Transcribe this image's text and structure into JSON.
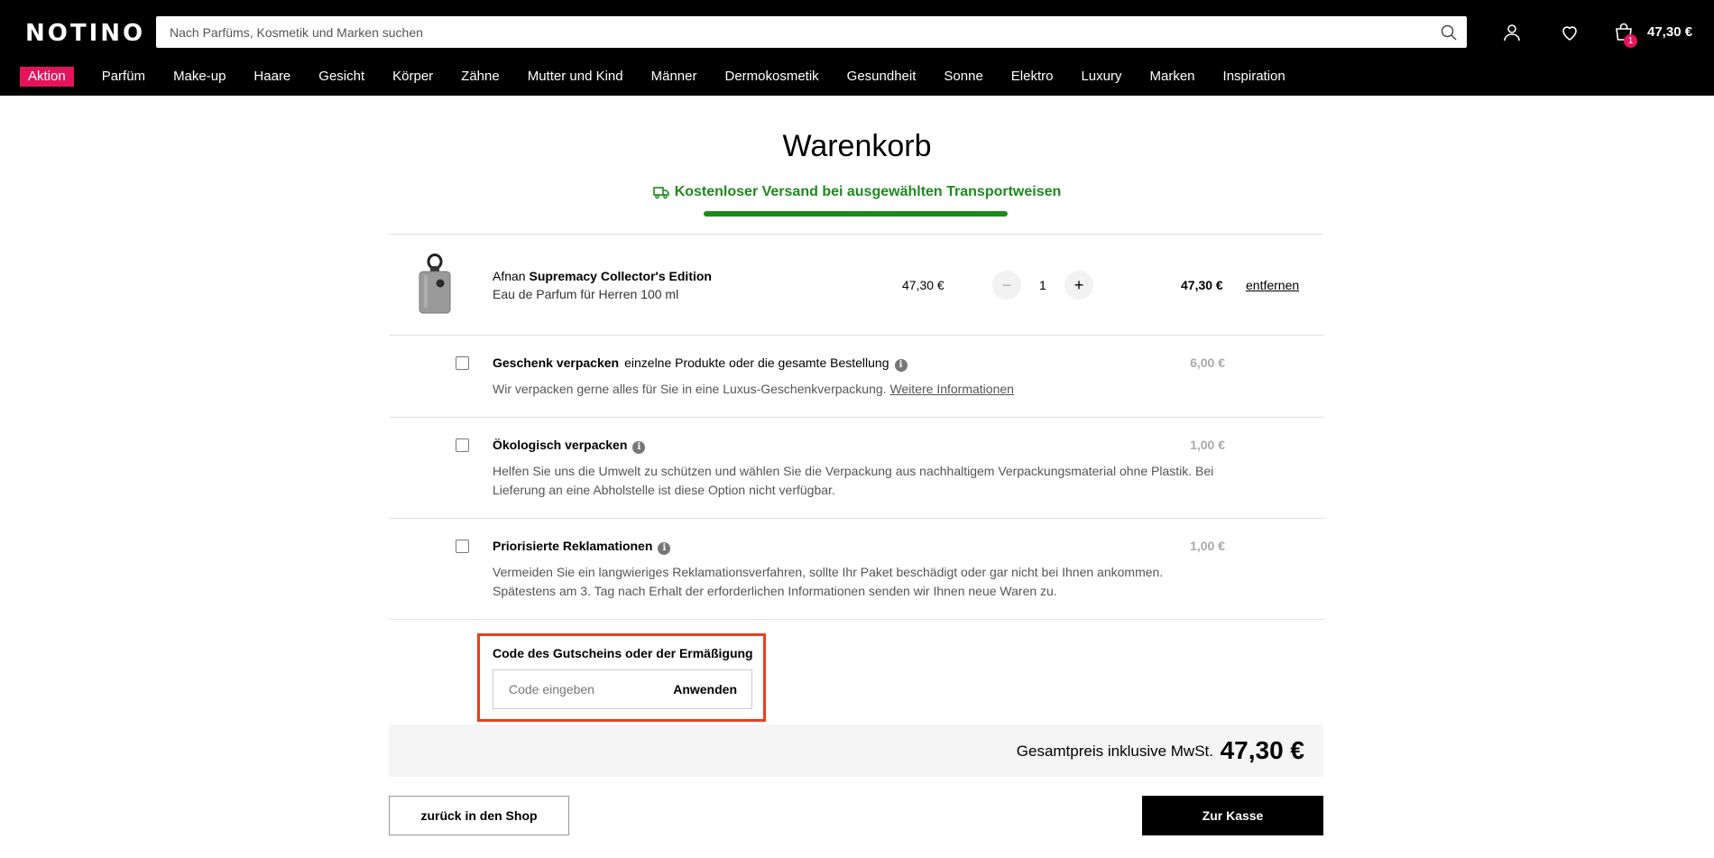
{
  "header": {
    "logo": "NOTINO",
    "search_placeholder": "Nach Parfüms, Kosmetik und Marken suchen",
    "cart_count": "1",
    "cart_total": "47,30 €"
  },
  "nav": {
    "items": [
      "Aktion",
      "Parfüm",
      "Make-up",
      "Haare",
      "Gesicht",
      "Körper",
      "Zähne",
      "Mutter und Kind",
      "Männer",
      "Dermokosmetik",
      "Gesundheit",
      "Sonne",
      "Elektro",
      "Luxury",
      "Marken",
      "Inspiration"
    ],
    "promo_color": "#e4145c"
  },
  "page": {
    "title": "Warenkorb",
    "shipping_text": "Kostenloser Versand bei ausgewählten Transportweisen",
    "shipping_progress": 1.0,
    "accent_green": "#1d8a1d"
  },
  "cart_item": {
    "brand": "Afnan",
    "name": "Supremacy Collector's Edition",
    "variant": "Eau de Parfum für Herren 100 ml",
    "unit_price": "47,30 €",
    "quantity": "1",
    "total": "47,30 €",
    "remove_label": "entfernen"
  },
  "options": [
    {
      "title": "Geschenk verpacken",
      "subtitle": "einzelne Produkte oder die gesamte Bestellung",
      "description": "Wir verpacken gerne alles für Sie in eine Luxus-Geschenkverpackung.",
      "link": "Weitere Informationen",
      "price": "6,00 €"
    },
    {
      "title": "Ökologisch verpacken",
      "description": "Helfen Sie uns die Umwelt zu schützen und wählen Sie die Verpackung aus nachhaltigem Verpackungsmaterial ohne Plastik. Bei Lieferung an eine Abholstelle ist diese Option nicht verfügbar.",
      "price": "1,00 €"
    },
    {
      "title": "Priorisierte Reklamationen",
      "description": "Vermeiden Sie ein langwieriges Reklamationsverfahren, sollte Ihr Paket beschädigt oder gar nicht bei Ihnen ankommen. Spätestens am 3. Tag nach Erhalt der erforderlichen Informationen senden wir Ihnen neue Waren zu.",
      "price": "1,00 €"
    }
  ],
  "voucher": {
    "label": "Code des Gutscheins oder der Ermäßigung",
    "placeholder": "Code eingeben",
    "apply_label": "Anwenden",
    "highlight_color": "#e5421b"
  },
  "summary": {
    "total_label": "Gesamtpreis inklusive MwSt.",
    "total_value": "47,30 €"
  },
  "actions": {
    "back_label": "zurück in den Shop",
    "checkout_label": "Zur Kasse"
  },
  "icons": [
    "search-icon",
    "user-icon",
    "heart-icon",
    "cart-icon",
    "truck-icon",
    "info-icon"
  ]
}
